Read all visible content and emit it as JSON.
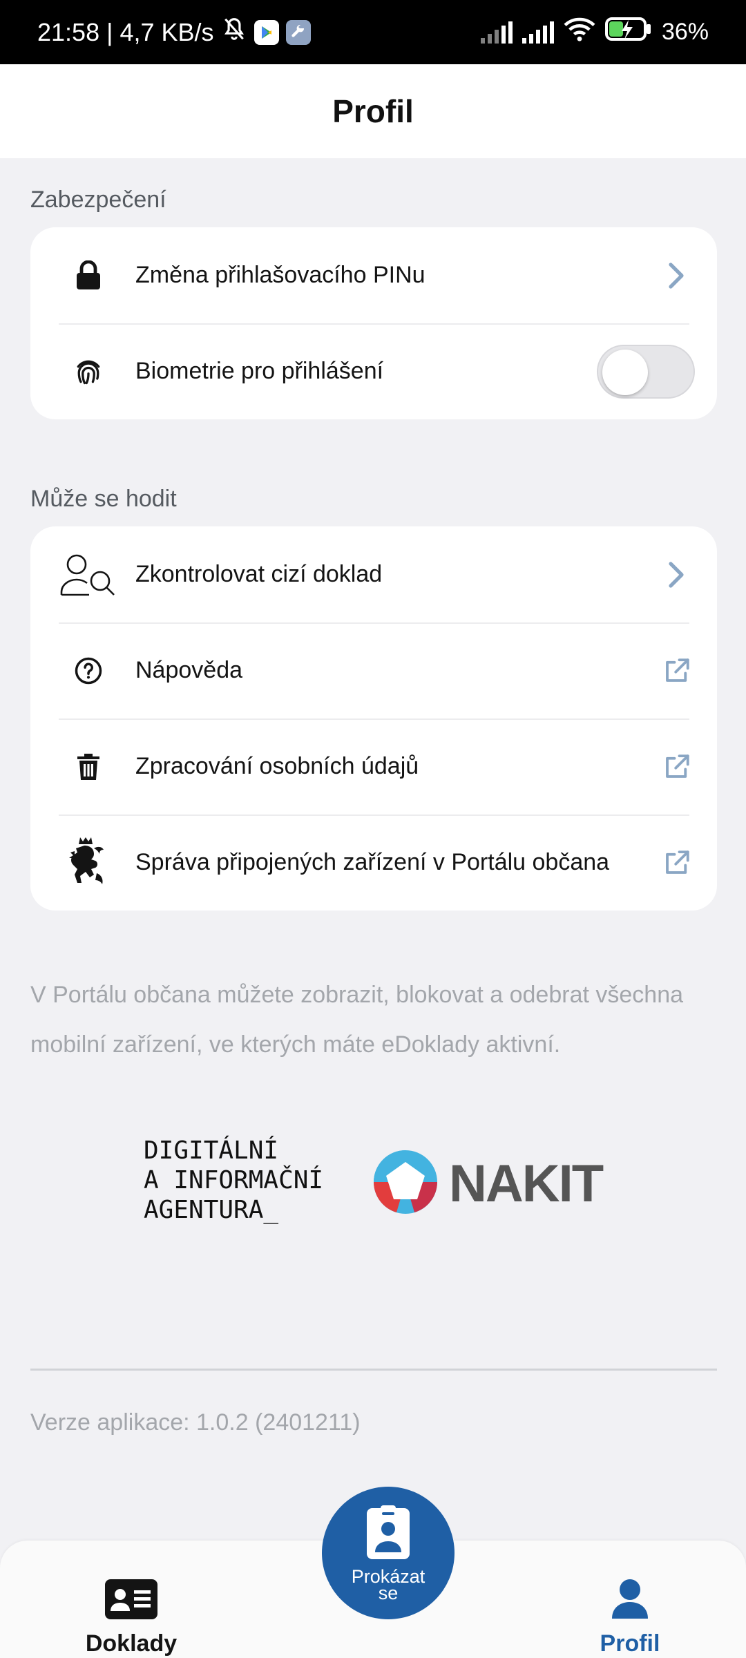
{
  "status_bar": {
    "time": "21:58",
    "separator": "|",
    "net_speed": "4,7 KB/s",
    "battery": "36%"
  },
  "header": {
    "title": "Profil"
  },
  "security": {
    "section_label": "Zabezpečení",
    "items": [
      {
        "label": "Změna přihlašovacího PINu",
        "icon": "lock-icon",
        "trailing": "chevron-right-icon"
      },
      {
        "label": "Biometrie pro přihlášení",
        "icon": "fingerprint-icon",
        "toggle_on": false
      }
    ]
  },
  "useful": {
    "section_label": "Může se hodit",
    "items": [
      {
        "label": "Zkontrolovat cizí doklad",
        "icon": "person-search-icon",
        "trailing": "chevron-right-icon"
      },
      {
        "label": "Nápověda",
        "icon": "help-icon",
        "trailing": "external-link-icon"
      },
      {
        "label": "Zpracování osobních údajů",
        "icon": "trash-icon",
        "trailing": "external-link-icon"
      },
      {
        "label": "Správa připojených zařízení v Portálu občana",
        "icon": "czech-lion-icon",
        "trailing": "external-link-icon"
      }
    ]
  },
  "info_text": "V Portálu občana můžete zobrazit, blokovat a odebrat všechna mobilní zařízení, ve kterých máte eDoklady aktivní.",
  "logos": {
    "dia_line1": "DIGITÁLNÍ",
    "dia_line2": "A INFORMAČNÍ",
    "dia_line3": "AGENTURA_",
    "nakit": "NAKIT"
  },
  "version": "Verze aplikace: 1.0.2 (2401211)",
  "bottom_nav": {
    "docs_label": "Doklady",
    "fab_label": "Prokázat se",
    "profile_label": "Profil"
  },
  "colors": {
    "accent": "#1f5fa5",
    "chevron": "#8aa6c4",
    "background": "#f1f1f4",
    "card": "#ffffff"
  }
}
